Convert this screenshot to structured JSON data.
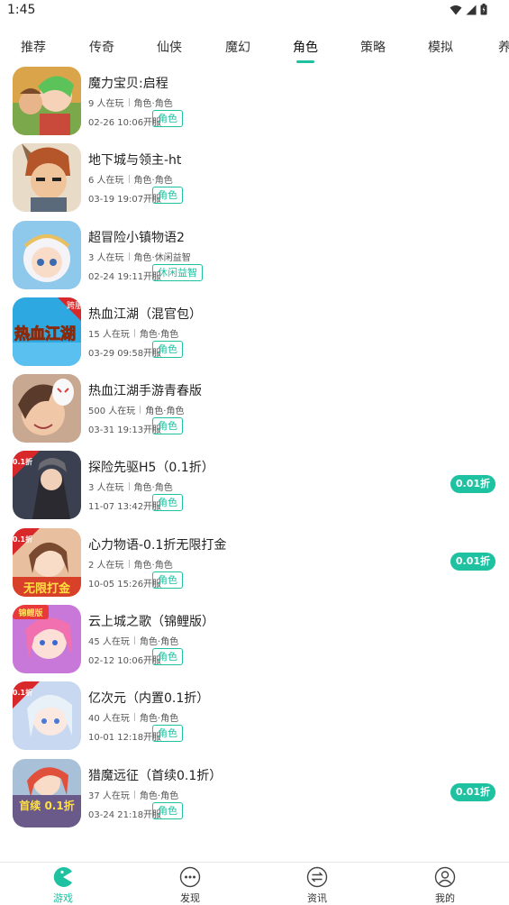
{
  "status_bar": {
    "time": "1:45"
  },
  "tabs": [
    {
      "label": "推荐"
    },
    {
      "label": "传奇"
    },
    {
      "label": "仙侠"
    },
    {
      "label": "魔幻"
    },
    {
      "label": "角色"
    },
    {
      "label": "策略"
    },
    {
      "label": "模拟"
    },
    {
      "label": "养"
    }
  ],
  "active_tab": "角色",
  "games": [
    {
      "title": "魔力宝贝:启程",
      "players": "9 人在玩",
      "genre": "角色·角色",
      "date": "02-26 10:06开服",
      "tag": "角色",
      "discount": ""
    },
    {
      "title": "地下城与领主-ht",
      "players": "6 人在玩",
      "genre": "角色·角色",
      "date": "03-19 19:07开服",
      "tag": "角色",
      "discount": ""
    },
    {
      "title": "超冒险小镇物语2",
      "players": "3 人在玩",
      "genre": "角色·休闲益智",
      "date": "02-24 19:11开服",
      "tag": "休闲益智",
      "discount": ""
    },
    {
      "title": "热血江湖（混官包）",
      "players": "15 人在玩",
      "genre": "角色·角色",
      "date": "03-29 09:58开服",
      "tag": "角色",
      "discount": ""
    },
    {
      "title": "热血江湖手游青春版",
      "players": "500 人在玩",
      "genre": "角色·角色",
      "date": "03-31 19:13开服",
      "tag": "角色",
      "discount": ""
    },
    {
      "title": "探险先驱H5（0.1折）",
      "players": "3 人在玩",
      "genre": "角色·角色",
      "date": "11-07 13:42开服",
      "tag": "角色",
      "discount": "0.01折"
    },
    {
      "title": "心力物语-0.1折无限打金",
      "players": "2 人在玩",
      "genre": "角色·角色",
      "date": "10-05 15:26开服",
      "tag": "角色",
      "discount": "0.01折"
    },
    {
      "title": "云上城之歌（锦鲤版）",
      "players": "45 人在玩",
      "genre": "角色·角色",
      "date": "02-12 10:06开服",
      "tag": "角色",
      "discount": ""
    },
    {
      "title": "亿次元（内置0.1折）",
      "players": "40 人在玩",
      "genre": "角色·角色",
      "date": "10-01 12:18开服",
      "tag": "角色",
      "discount": ""
    },
    {
      "title": "猎魔远征（首续0.1折）",
      "players": "37 人在玩",
      "genre": "角色·角色",
      "date": "03-24 21:18开服",
      "tag": "角色",
      "discount": "0.01折"
    }
  ],
  "icon_art": {
    "badges": [
      "",
      "",
      "",
      "跨服",
      "",
      "0.1折",
      "0.1折",
      "锦鲤版",
      "0.1折",
      ""
    ],
    "captions": [
      "",
      "",
      "",
      "热血江湖",
      "",
      "",
      "无限打金",
      "",
      "",
      "首续 0.1折"
    ]
  },
  "bottom_nav": [
    {
      "label": "游戏",
      "icon": "game-pacman-icon"
    },
    {
      "label": "发现",
      "icon": "discover-dots-icon"
    },
    {
      "label": "资讯",
      "icon": "news-exchange-icon"
    },
    {
      "label": "我的",
      "icon": "profile-user-icon"
    }
  ],
  "active_nav": "游戏",
  "colors": {
    "accent": "#1ec1a0",
    "text": "#222222",
    "meta": "#555555",
    "divider": "#e6e6e6"
  }
}
